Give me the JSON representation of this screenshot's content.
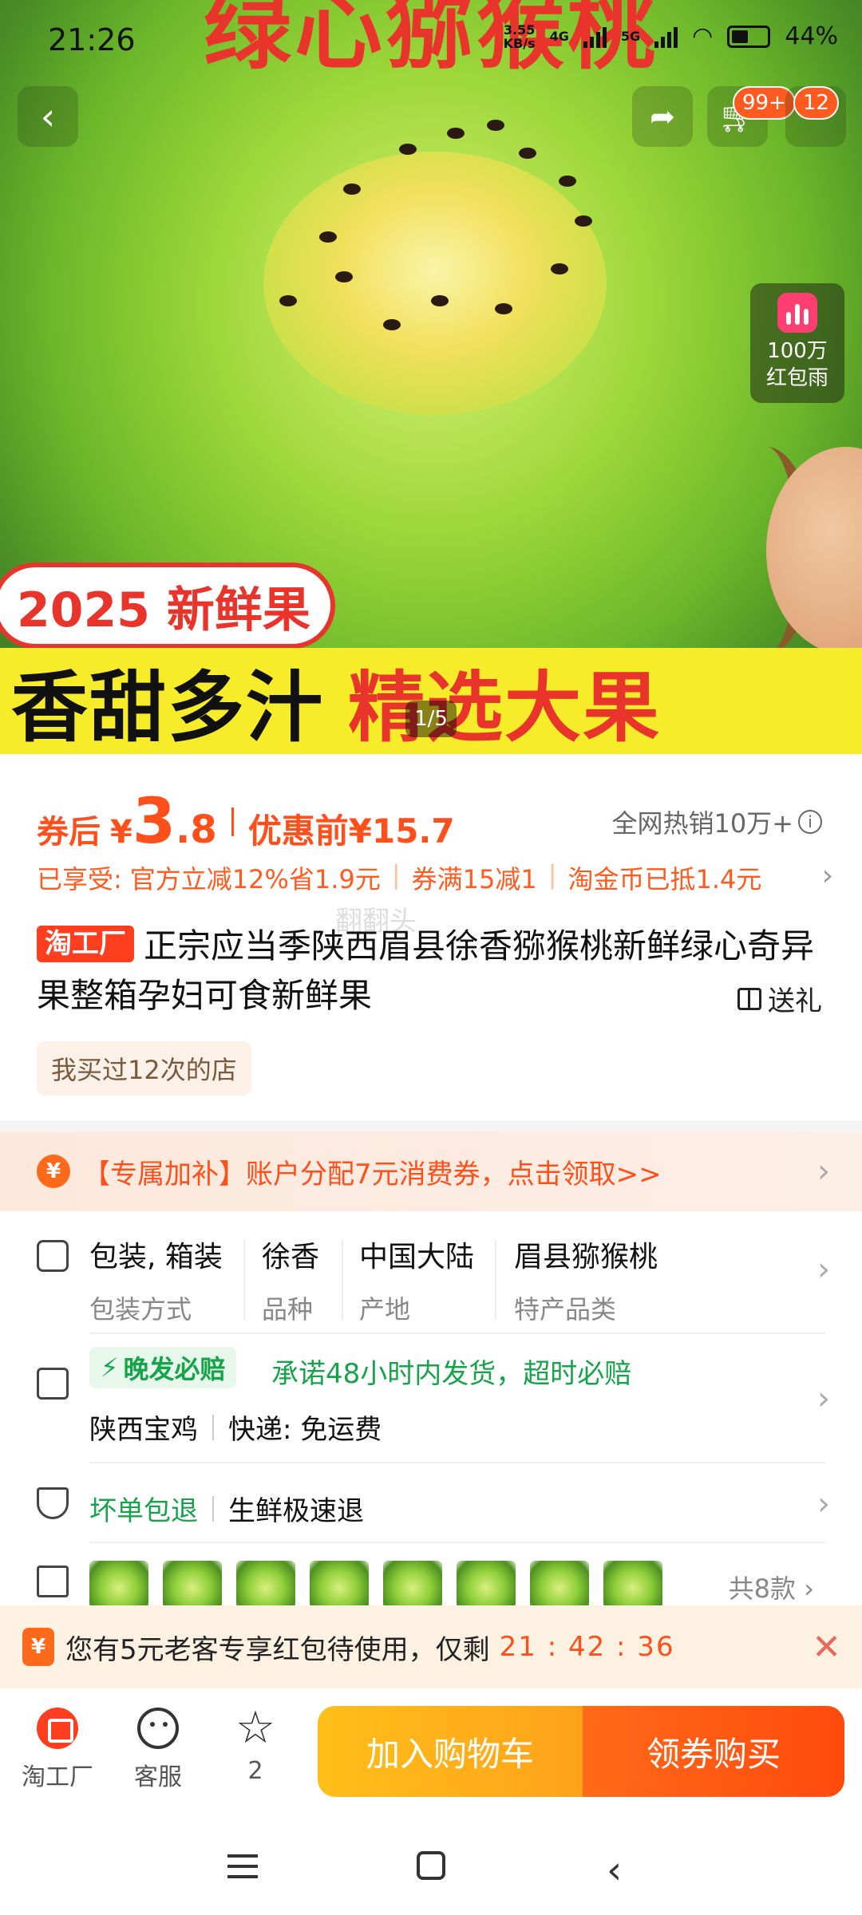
{
  "status_bar": {
    "time": "21:26",
    "net_speed_top": "3.55",
    "net_speed_unit": "KB/s",
    "net_4g": "4G",
    "net_5g": "5G",
    "battery": "44%"
  },
  "hero": {
    "top_text": "绿心猕猴桃",
    "badge_cart": "99+",
    "badge_more": "12",
    "rain_line1": "100万",
    "rain_line2": "红包雨",
    "banner_red": "2025 新鲜果",
    "banner_black": "香甜多汁",
    "banner_red2": "精选大果",
    "pager": "1/5"
  },
  "price": {
    "label": "券后",
    "yen": "¥",
    "int": "3",
    "dec": ".8",
    "original": "优惠前¥15.7",
    "hot_sales": "全网热销10万+"
  },
  "promo": {
    "prefix": "已享受:",
    "item1": "官方立减12%省1.9元",
    "item2": "券满15减1",
    "item3": "淘金币已抵1.4元"
  },
  "watermark": "翻翻头",
  "product": {
    "tag": "淘工厂",
    "title": "正宗应当季陕西眉县徐香猕猴桃新鲜绿心奇异果整箱孕妇可食新鲜果",
    "gift_label": "送礼",
    "bought_badge": "我买过12次的店"
  },
  "coupon": {
    "icon": "¥",
    "text": "【专属加补】账户分配7元消费券，点击领取>>"
  },
  "attributes": [
    {
      "value": "包装, 箱装",
      "key": "包装方式"
    },
    {
      "value": "徐香",
      "key": "品种"
    },
    {
      "value": "中国大陆",
      "key": "产地"
    },
    {
      "value": "眉县猕猴桃",
      "key": "特产品类"
    }
  ],
  "shipping": {
    "tag": "晚发必赔",
    "promise": "承诺48小时内发货，超时必赔",
    "origin": "陕西宝鸡",
    "courier": "快递:  免运费"
  },
  "guarantee": {
    "label1": "坏单包退",
    "label2": "生鲜极速退"
  },
  "variants": {
    "count_text": "共8款"
  },
  "timer": {
    "icon": "¥",
    "text": "您有5元老客专享红包待使用，仅剩",
    "countdown": "21 : 42 : 36"
  },
  "bottom_bar": {
    "tab_factory": "淘工厂",
    "tab_service": "客服",
    "tab_fav_count": "2",
    "add_cart": "加入购物车",
    "buy": "领券购买"
  },
  "colors": {
    "accent_orange": "#ff4f1a",
    "green": "#17a34a",
    "cart_yellow": "#ffb01a"
  }
}
